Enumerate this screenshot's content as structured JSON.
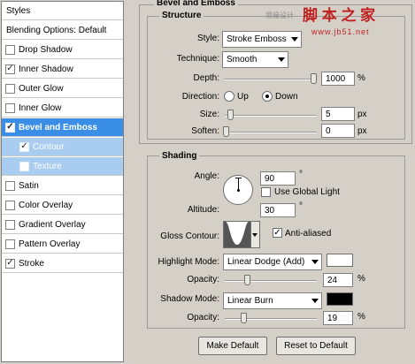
{
  "styles_list": {
    "header": "Styles",
    "blending": "Blending Options: Default",
    "items": [
      {
        "label": "Drop Shadow",
        "checked": false,
        "check": ""
      },
      {
        "label": "Inner Shadow",
        "checked": true,
        "check": "✓"
      },
      {
        "label": "Outer Glow",
        "checked": false,
        "check": ""
      },
      {
        "label": "Inner Glow",
        "checked": false,
        "check": ""
      },
      {
        "label": "Bevel and Emboss",
        "checked": true,
        "check": "✓"
      },
      {
        "label": "Contour",
        "checked": true,
        "check": "✓"
      },
      {
        "label": "Texture",
        "checked": false,
        "check": ""
      },
      {
        "label": "Satin",
        "checked": false,
        "check": ""
      },
      {
        "label": "Color Overlay",
        "checked": false,
        "check": ""
      },
      {
        "label": "Gradient Overlay",
        "checked": false,
        "check": ""
      },
      {
        "label": "Pattern Overlay",
        "checked": false,
        "check": ""
      },
      {
        "label": "Stroke",
        "checked": true,
        "check": "✓"
      }
    ]
  },
  "bevel": {
    "title": "Bevel and Emboss",
    "structure_title": "Structure",
    "style_label": "Style:",
    "style_value": "Stroke Emboss",
    "technique_label": "Technique:",
    "technique_value": "Smooth",
    "depth_label": "Depth:",
    "depth_value": "1000",
    "depth_unit": "%",
    "direction_label": "Direction:",
    "direction_up": "Up",
    "direction_down": "Down",
    "direction_selected": "Down",
    "size_label": "Size:",
    "size_value": "5",
    "size_unit": "px",
    "soften_label": "Soften:",
    "soften_value": "0",
    "soften_unit": "px"
  },
  "shading": {
    "title": "Shading",
    "angle_label": "Angle:",
    "angle_value": "90",
    "angle_unit": "°",
    "global_light_label": "Use Global Light",
    "global_light_checked": false,
    "altitude_label": "Altitude:",
    "altitude_value": "30",
    "altitude_unit": "°",
    "gloss_label": "Gloss Contour:",
    "anti_aliased_label": "Anti-aliased",
    "anti_aliased_check": "✓",
    "highlight_mode_label": "Highlight Mode:",
    "highlight_mode_value": "Linear Dodge (Add)",
    "highlight_color": "#ffffff",
    "highlight_opacity_label": "Opacity:",
    "highlight_opacity_value": "24",
    "highlight_opacity_unit": "%",
    "shadow_mode_label": "Shadow Mode:",
    "shadow_mode_value": "Linear Burn",
    "shadow_color": "#000000",
    "shadow_opacity_label": "Opacity:",
    "shadow_opacity_value": "19",
    "shadow_opacity_unit": "%"
  },
  "buttons": {
    "make_default": "Make Default",
    "reset_default": "Reset to Default"
  },
  "watermark": {
    "line1_small": "思缘设计",
    "line1_brand": "脚 本 之 家",
    "line2": "www.jb51.net"
  },
  "colors": {
    "selected_row": "#3a8ee6",
    "selected_sub_row": "#a9cdf1",
    "panel_bg": "#d4d0c8"
  }
}
